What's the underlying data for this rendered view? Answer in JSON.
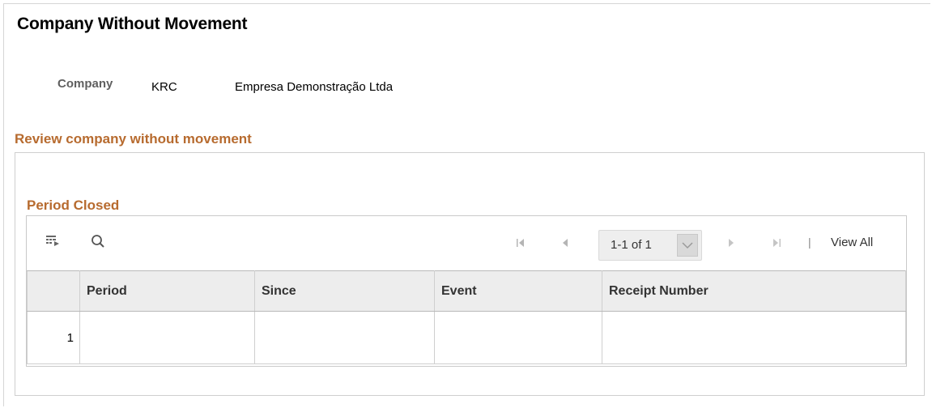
{
  "page": {
    "title": "Company Without Movement"
  },
  "company": {
    "label": "Company",
    "code": "KRC",
    "name": "Empresa Demonstração Ltda"
  },
  "section": {
    "title": "Review company without movement"
  },
  "grid": {
    "title": "Period Closed",
    "toolbar": {
      "personalize_icon": "grid-personalize-icon",
      "search_icon": "search-icon",
      "pager_text": "1-1 of 1",
      "separator": "|",
      "view_all": "View All"
    },
    "columns": [
      "",
      "Period",
      "Since",
      "Event",
      "Receipt Number"
    ],
    "rows": [
      {
        "num": "1",
        "period": "",
        "since": "",
        "event": "",
        "receipt_number": ""
      }
    ]
  },
  "colors": {
    "section_heading": "#b76b2f",
    "header_bg": "#ededed"
  }
}
